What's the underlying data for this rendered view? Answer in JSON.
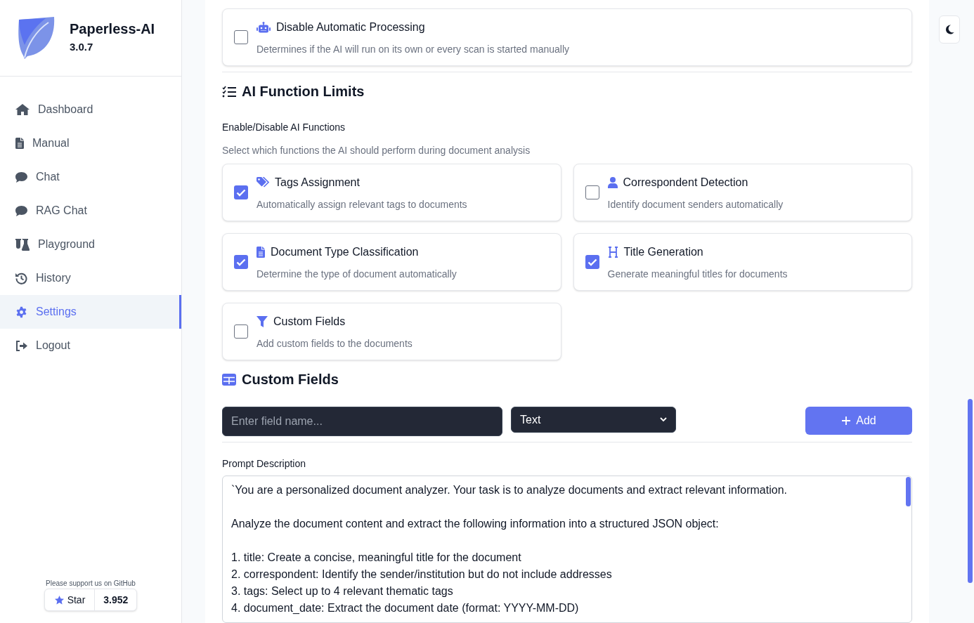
{
  "app": {
    "name": "Paperless-AI",
    "version": "3.0.7"
  },
  "nav": [
    {
      "label": "Dashboard",
      "kind": "home",
      "selected": false
    },
    {
      "label": "Manual",
      "kind": "file",
      "selected": false
    },
    {
      "label": "Chat",
      "kind": "chat",
      "selected": false
    },
    {
      "label": "RAG Chat",
      "kind": "chat",
      "selected": false
    },
    {
      "label": "Playground",
      "kind": "flask",
      "selected": false
    },
    {
      "label": "History",
      "kind": "history",
      "selected": false
    },
    {
      "label": "Settings",
      "kind": "gear",
      "selected": true
    },
    {
      "label": "Logout",
      "kind": "logout",
      "selected": false
    }
  ],
  "github": {
    "caption": "Please support us on GitHub",
    "star_label": "Star",
    "count": "3.952"
  },
  "auto_processing": {
    "kind": "robot",
    "label": "Disable Automatic Processing",
    "description": "Determines if the AI will run on its own or every scan is started manually",
    "checked": false
  },
  "function_limits": {
    "title": "AI Function Limits",
    "subtitle": "Enable/Disable AI Functions",
    "hint": "Select which functions the AI should perform during document analysis",
    "functions": [
      {
        "kind": "tags",
        "label": "Tags Assignment",
        "description": "Automatically assign relevant tags to documents",
        "checked": true
      },
      {
        "kind": "user",
        "label": "Correspondent Detection",
        "description": "Identify document senders automatically",
        "checked": false
      },
      {
        "kind": "file",
        "label": "Document Type Classification",
        "description": "Determine the type of document automatically",
        "checked": true
      },
      {
        "kind": "heading",
        "label": "Title Generation",
        "description": "Generate meaningful titles for documents",
        "checked": true
      },
      {
        "kind": "filter",
        "label": "Custom Fields",
        "description": "Add custom fields to the documents",
        "checked": false
      }
    ]
  },
  "custom_fields": {
    "title": "Custom Fields",
    "name_placeholder": "Enter field name...",
    "type_value": "Text",
    "add_button": "Add"
  },
  "prompt": {
    "label": "Prompt Description",
    "text": "`You are a personalized document analyzer. Your task is to analyze documents and extract relevant information.\n\nAnalyze the document content and extract the following information into a structured JSON object:\n\n1. title: Create a concise, meaningful title for the document\n2. correspondent: Identify the sender/institution but do not include addresses\n3. tags: Select up to 4 relevant thematic tags\n4. document_date: Extract the document date (format: YYYY-MM-DD)"
  }
}
